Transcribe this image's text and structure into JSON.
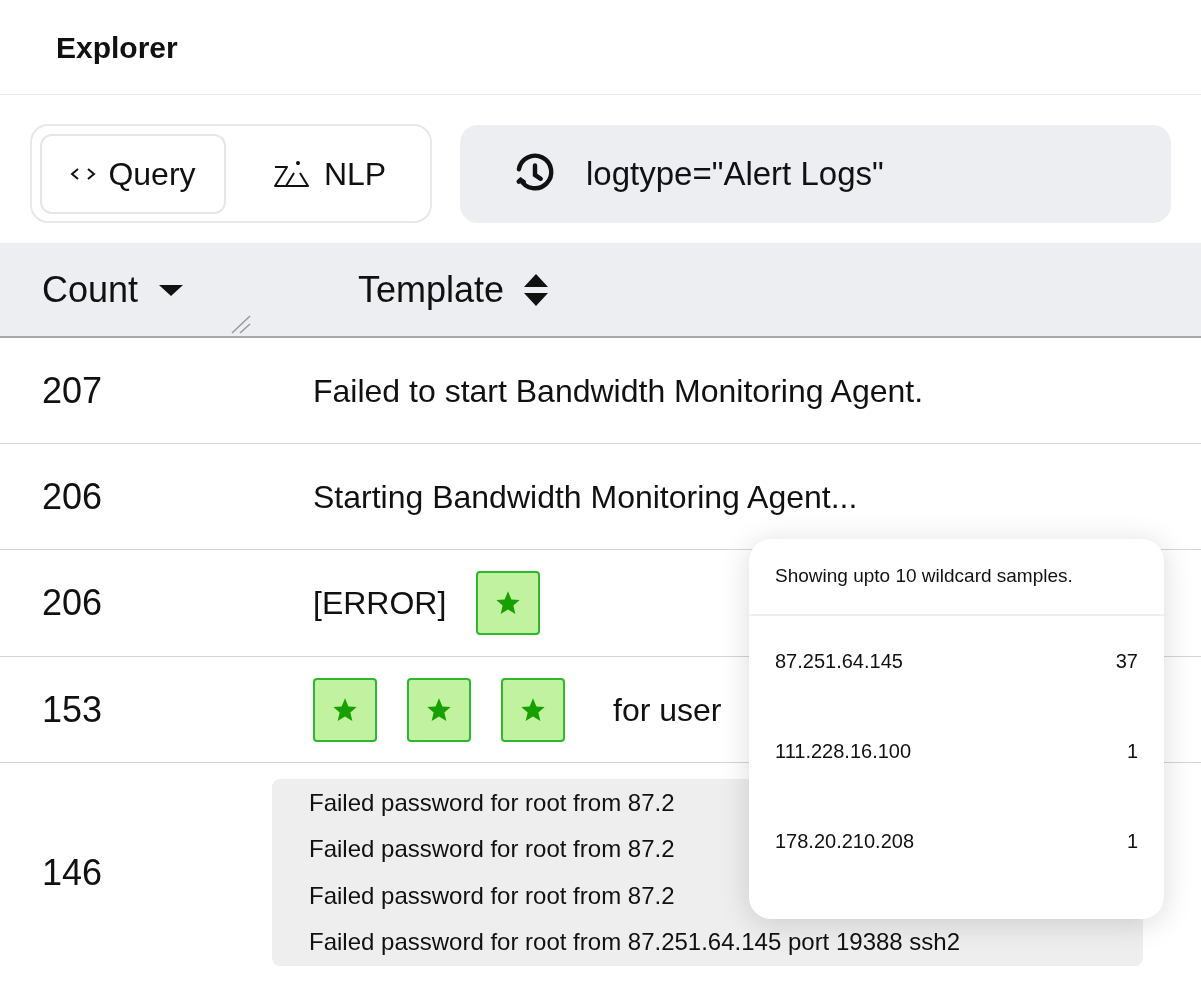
{
  "title": "Explorer",
  "mode_tabs": [
    {
      "label": "Query",
      "kind": "code",
      "selected": true
    },
    {
      "label": "NLP",
      "kind": "nlp",
      "selected": false
    }
  ],
  "query": {
    "value": "logtype=\"Alert Logs\""
  },
  "table": {
    "columns": [
      {
        "label": "Count",
        "sorted": true
      },
      {
        "label": "Template",
        "sorted": false
      }
    ],
    "rows": [
      {
        "count": "207",
        "template": [
          {
            "kind": "text",
            "text": "Failed to start Bandwidth Monitoring Agent."
          }
        ]
      },
      {
        "count": "206",
        "template": [
          {
            "kind": "text",
            "text": "Starting Bandwidth Monitoring Agent..."
          }
        ]
      },
      {
        "count": "206",
        "template": [
          {
            "kind": "text",
            "text": "[ERROR]"
          },
          {
            "kind": "wildcard"
          }
        ]
      },
      {
        "count": "153",
        "template": [
          {
            "kind": "wildcard"
          },
          {
            "kind": "wildcard"
          },
          {
            "kind": "wildcard"
          },
          {
            "kind": "text",
            "text": "for user"
          }
        ]
      },
      {
        "count": "146",
        "samples": [
          "Failed password for root from 87.2",
          "Failed password for root from 87.2",
          "Failed password for root from 87.2",
          "Failed password for root from 87.251.64.145 port 19388 ssh2"
        ]
      }
    ]
  },
  "popup": {
    "header": "Showing upto 10 wildcard samples.",
    "items": [
      {
        "value": "87.251.64.145",
        "count": "37"
      },
      {
        "value": "111.228.16.100",
        "count": "1"
      },
      {
        "value": "178.20.210.208",
        "count": "1"
      }
    ]
  }
}
